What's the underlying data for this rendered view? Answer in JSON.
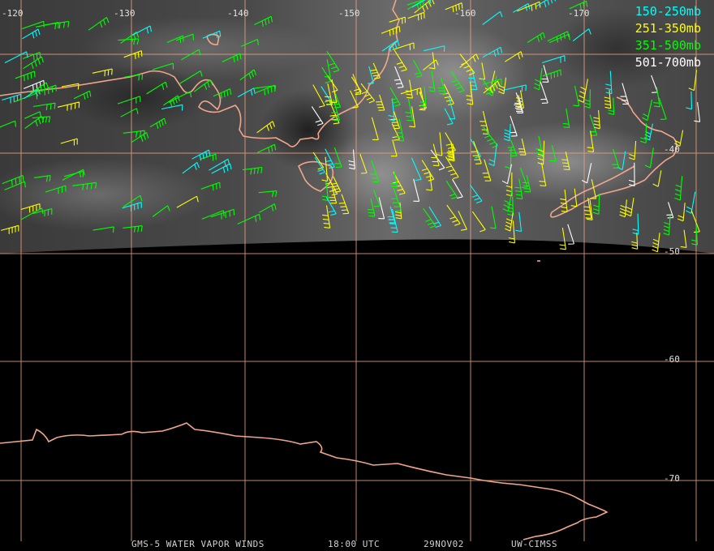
{
  "map": {
    "longitude_labels": [
      "-120",
      "-130",
      "-140",
      "-150",
      "-160",
      "-170"
    ],
    "latitude_labels": [
      "-40",
      "-50",
      "-60",
      "-70"
    ],
    "grid_color": "#e8a080",
    "coast_color": "#f0a68c"
  },
  "legend": [
    {
      "label": "150-250mb",
      "color": "#00ffff"
    },
    {
      "label": "251-350mb",
      "color": "#ffff00"
    },
    {
      "label": "351-500mb",
      "color": "#00ff00"
    },
    {
      "label": "501-700mb",
      "color": "#ffffff"
    }
  ],
  "footer": {
    "product": "GMS-5 WATER VAPOR WINDS",
    "time": "18:00 UTC",
    "date": "29NOV02",
    "source": "UW-CIMSS"
  }
}
